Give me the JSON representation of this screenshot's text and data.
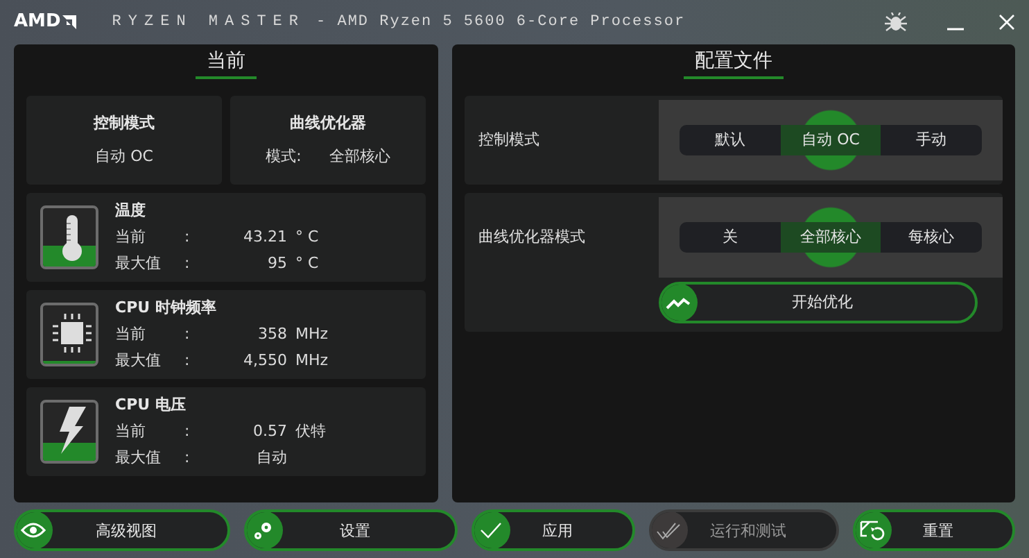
{
  "window": {
    "logo": "AMD",
    "app_name": "RYZEN MASTER",
    "subtitle": "- AMD Ryzen 5 5600 6-Core Processor"
  },
  "current": {
    "title": "当前",
    "summary": [
      {
        "label": "控制模式",
        "value": "自动 OC"
      },
      {
        "label": "曲线优化器",
        "value_label": "模式:",
        "value": "全部核心"
      }
    ],
    "stats": [
      {
        "title": "温度",
        "current_label": "当前",
        "separator": ":",
        "current": "43.21",
        "current_unit": "° C",
        "max_label": "最大值",
        "max_separator": ":",
        "max": "95",
        "max_unit": "° C",
        "level": 0.35
      },
      {
        "title": "CPU 时钟频率",
        "current_label": "当前",
        "separator": ":",
        "current": "358",
        "current_unit": "MHz",
        "max_label": "最大值",
        "max_separator": ":",
        "max": "4,550",
        "max_unit": "MHz",
        "level": 0.05
      },
      {
        "title": "CPU 电压",
        "current_label": "当前",
        "separator": ":",
        "current": "0.57",
        "current_unit": "伏特",
        "max_label": "最大值",
        "max_separator": ":",
        "max": "自动",
        "level": 0.3
      }
    ]
  },
  "profile": {
    "title": "配置文件",
    "control_mode": {
      "label": "控制模式",
      "options": [
        {
          "label": "默认",
          "selected": false
        },
        {
          "label": "自动 OC",
          "selected": true
        },
        {
          "label": "手动",
          "selected": false
        }
      ]
    },
    "curve_optimizer": {
      "label": "曲线优化器模式",
      "options": [
        {
          "label": "关",
          "selected": false
        },
        {
          "label": "全部核心",
          "selected": true
        },
        {
          "label": "每核心",
          "selected": false
        }
      ],
      "action": "开始优化"
    }
  },
  "buttons": [
    {
      "label": "高级视图",
      "disabled": false
    },
    {
      "label": "设置",
      "disabled": false
    },
    {
      "label": "应用",
      "disabled": false
    },
    {
      "label": "运行和测试",
      "disabled": true
    },
    {
      "label": "重置",
      "disabled": false
    }
  ]
}
